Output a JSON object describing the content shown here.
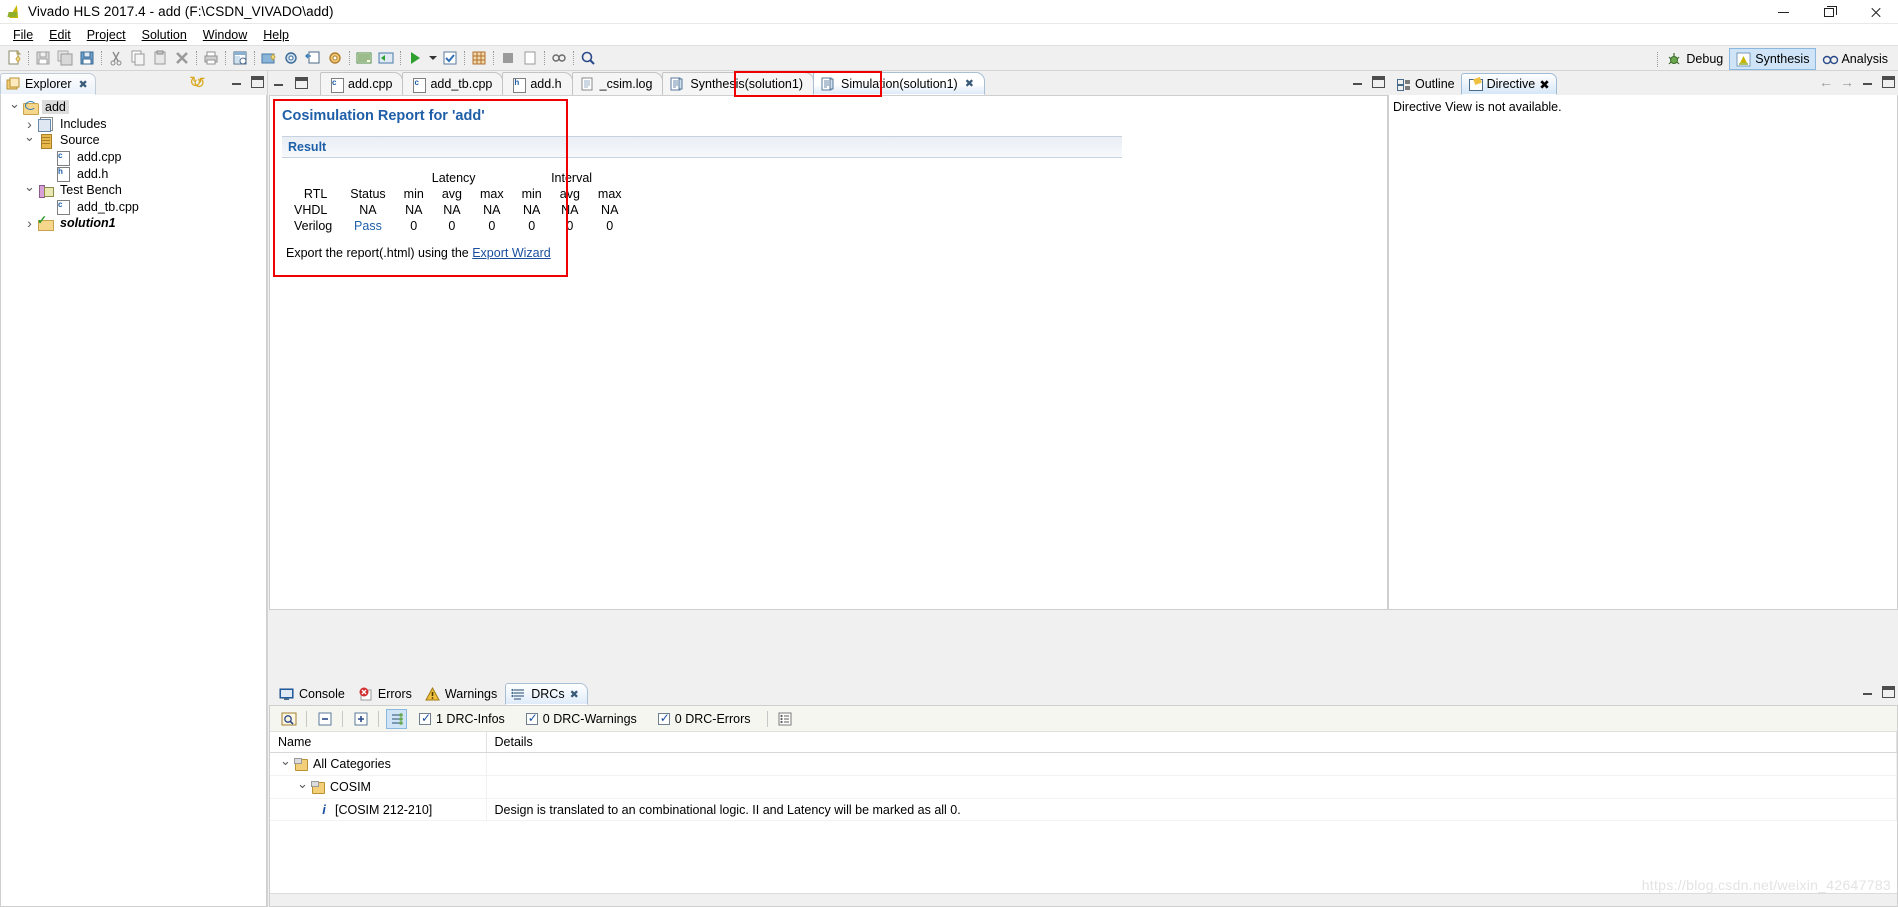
{
  "window": {
    "title": "Vivado HLS 2017.4 - add (F:\\CSDN_VIVADO\\add)",
    "app_icon": "vivado-logo-icon",
    "controls": {
      "minimize": "minimize-icon",
      "restore": "restore-icon",
      "close": "close-icon"
    }
  },
  "menu": {
    "items": [
      {
        "label": "File"
      },
      {
        "label": "Edit"
      },
      {
        "label": "Project"
      },
      {
        "label": "Solution"
      },
      {
        "label": "Window"
      },
      {
        "label": "Help"
      }
    ]
  },
  "toolbar": {
    "buttons": [
      {
        "name": "new-icon"
      },
      {
        "name": "save-icon"
      },
      {
        "name": "save-all-icon"
      },
      {
        "name": "save-as-icon"
      },
      {
        "name": "cut-icon"
      },
      {
        "name": "copy-icon"
      },
      {
        "name": "paste-icon"
      },
      {
        "name": "delete-icon"
      },
      {
        "name": "print-icon"
      },
      {
        "name": "open-report-icon"
      },
      {
        "name": "new-solution-icon"
      },
      {
        "name": "project-settings-icon"
      },
      {
        "name": "add-directive-icon"
      },
      {
        "name": "solution-settings-icon"
      },
      {
        "name": "c-simulation-icon"
      },
      {
        "name": "c-synthesis-icon"
      },
      {
        "name": "run-icon"
      },
      {
        "name": "cosim-icon"
      },
      {
        "name": "export-rtl-icon"
      },
      {
        "name": "stop-icon"
      },
      {
        "name": "terminate-icon"
      },
      {
        "name": "link-icon"
      },
      {
        "name": "search-icon"
      }
    ]
  },
  "perspectives": {
    "items": [
      {
        "label": "Debug",
        "icon": "debug-icon",
        "active": false
      },
      {
        "label": "Synthesis",
        "icon": "synthesis-icon",
        "active": true
      },
      {
        "label": "Analysis",
        "icon": "analysis-icon",
        "active": false
      }
    ]
  },
  "explorer": {
    "tab_label": "Explorer",
    "tab_icon": "explorer-icon",
    "close_glyph": "✖",
    "refresh_icon": "refresh-icon",
    "tree": [
      {
        "label": "add",
        "icon": "project-folder-icon",
        "indent": 0,
        "twisty": "expanded",
        "selected": true
      },
      {
        "label": "Includes",
        "icon": "includes-icon",
        "indent": 1,
        "twisty": "collapsed"
      },
      {
        "label": "Source",
        "icon": "source-folder-icon",
        "indent": 1,
        "twisty": "expanded"
      },
      {
        "label": "add.cpp",
        "icon": "c-file-icon",
        "indent": 2,
        "twisty": "none"
      },
      {
        "label": "add.h",
        "icon": "h-file-icon",
        "indent": 2,
        "twisty": "none"
      },
      {
        "label": "Test Bench",
        "icon": "testbench-icon",
        "indent": 1,
        "twisty": "expanded"
      },
      {
        "label": "add_tb.cpp",
        "icon": "c-file-icon",
        "indent": 2,
        "twisty": "none"
      },
      {
        "label": "solution1",
        "icon": "solution-icon",
        "indent": 1,
        "twisty": "collapsed",
        "bold_italic": true
      }
    ]
  },
  "editor": {
    "tabs": [
      {
        "label": "add.cpp",
        "icon": "c-file-icon",
        "active": false,
        "closable": false
      },
      {
        "label": "add_tb.cpp",
        "icon": "c-file-icon",
        "active": false,
        "closable": false
      },
      {
        "label": "add.h",
        "icon": "h-file-icon",
        "active": false,
        "closable": false
      },
      {
        "label": "_csim.log",
        "icon": "log-file-icon",
        "active": false,
        "closable": false
      },
      {
        "label": "Synthesis(solution1)",
        "icon": "report-icon",
        "active": false,
        "closable": false
      },
      {
        "label": "Simulation(solution1)",
        "icon": "report-icon",
        "active": true,
        "closable": true,
        "close_glyph": "✖",
        "highlighted": true
      }
    ],
    "view_controls": {
      "minimize": "minimize-view-icon",
      "maximize": "maximize-view-icon"
    }
  },
  "report": {
    "title": "Cosimulation Report for 'add'",
    "section_title": "Result",
    "table": {
      "group_headers": [
        "Latency",
        "Interval"
      ],
      "columns": [
        "RTL",
        "Status",
        "min",
        "avg",
        "max",
        "min",
        "avg",
        "max"
      ],
      "rows": [
        {
          "cells": [
            "VHDL",
            "NA",
            "NA",
            "NA",
            "NA",
            "NA",
            "NA",
            "NA"
          ],
          "status_pass": false
        },
        {
          "cells": [
            "Verilog",
            "Pass",
            "0",
            "0",
            "0",
            "0",
            "0",
            "0"
          ],
          "status_pass": true
        }
      ]
    },
    "export_text": "Export the report(.html) using the",
    "export_link": "Export Wizard",
    "annotation_color": "#ee0000"
  },
  "right_panel": {
    "tabs": [
      {
        "label": "Outline",
        "icon": "outline-icon",
        "active": false,
        "closable": false
      },
      {
        "label": "Directive",
        "icon": "directive-icon",
        "active": true,
        "closable": true,
        "close_glyph": "✖"
      }
    ],
    "message": "Directive View is not available.",
    "nav_back": "←",
    "nav_forward": "→",
    "view_controls": {
      "minimize": "minimize-view-icon",
      "maximize": "maximize-view-icon"
    }
  },
  "console_panel": {
    "tabs": [
      {
        "label": "Console",
        "icon": "console-icon",
        "active": false,
        "closable": false
      },
      {
        "label": "Errors",
        "icon": "errors-icon",
        "active": false,
        "closable": false
      },
      {
        "label": "Warnings",
        "icon": "warnings-icon",
        "active": false,
        "closable": false
      },
      {
        "label": "DRCs",
        "icon": "drcs-icon",
        "active": true,
        "closable": true,
        "close_glyph": "✖"
      }
    ],
    "view_controls": {
      "minimize": "minimize-view-icon",
      "maximize": "maximize-view-icon"
    },
    "drc_toolbar": {
      "buttons": [
        {
          "name": "find-icon",
          "pressed": false
        },
        {
          "name": "collapse-all-icon",
          "pressed": false
        },
        {
          "name": "expand-all-icon",
          "pressed": false
        },
        {
          "name": "group-by-icon",
          "pressed": true
        }
      ],
      "filters": [
        {
          "label": "1 DRC-Infos",
          "checked": true
        },
        {
          "label": "0 DRC-Warnings",
          "checked": true
        },
        {
          "label": "0 DRC-Errors",
          "checked": true
        }
      ],
      "menu_icon": "view-menu-icon"
    },
    "table": {
      "columns": [
        "Name",
        "Details"
      ],
      "rows": [
        {
          "name": "All Categories",
          "details": "",
          "indent": 0,
          "twisty": "expanded",
          "icon": "category-icon"
        },
        {
          "name": "COSIM",
          "details": "",
          "indent": 1,
          "twisty": "expanded",
          "icon": "category-icon"
        },
        {
          "name": "[COSIM 212-210]",
          "details": "Design is translated to an combinational logic. II and Latency will be marked as all 0.",
          "indent": 2,
          "twisty": "none",
          "icon": "info-icon"
        }
      ]
    }
  },
  "watermark": {
    "text": "https://blog.csdn.net/weixin_42647783"
  }
}
